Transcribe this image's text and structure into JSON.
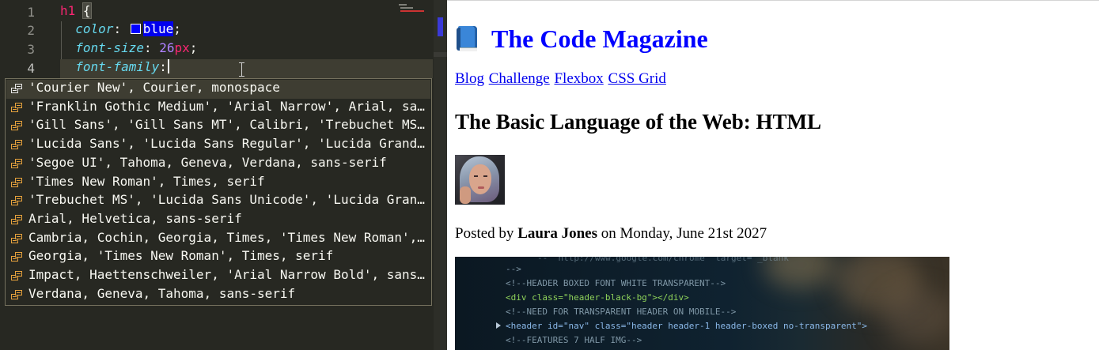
{
  "editor": {
    "line_numbers": [
      "1",
      "2",
      "3",
      "4"
    ],
    "code": {
      "selector": "h1",
      "open_brace": "{",
      "line2": {
        "prop": "color",
        "value": "blue"
      },
      "line3": {
        "prop": "font-size",
        "number": "26",
        "unit": "px"
      },
      "line4": {
        "prop": "font-family"
      },
      "colon": ":",
      "semicolon": ";"
    },
    "swatch_color": "#0000ff",
    "suggestions": [
      "'Courier New', Courier, monospace",
      "'Franklin Gothic Medium', 'Arial Narrow', Arial, sans-serif",
      "'Gill Sans', 'Gill Sans MT', Calibri, 'Trebuchet MS', sans-serif",
      "'Lucida Sans', 'Lucida Sans Regular', 'Lucida Grande', 'Lucida Sans Unicode', Geneva, Verdana, sans-serif",
      "'Segoe UI', Tahoma, Geneva, Verdana, sans-serif",
      "'Times New Roman', Times, serif",
      "'Trebuchet MS', 'Lucida Sans Unicode', 'Lucida Grande', 'Lucida Sans', Arial, sans-serif",
      "Arial, Helvetica, sans-serif",
      "Cambria, Cochin, Georgia, Times, 'Times New Roman', serif",
      "Georgia, 'Times New Roman', Times, serif",
      "Impact, Haettenschweiler, 'Arial Narrow Bold', sans-serif",
      "Verdana, Geneva, Tahoma, sans-serif"
    ],
    "suggestion_icon": "value-snippet-icon",
    "selected_suggestion": "'Courier New', Courier, monospace"
  },
  "preview": {
    "title": "The Code Magazine",
    "title_icon": "blue-book-icon",
    "title_color": "#0000ff",
    "nav": [
      "Blog",
      "Challenge",
      "Flexbox",
      "CSS Grid"
    ],
    "heading": "The Basic Language of the Web: HTML",
    "avatar": "author-photo",
    "posted_prefix": "Posted by",
    "author": "Laura Jones",
    "posted_suffix": "on Monday, June 21st 2027",
    "hero_image": "html-code-screenshot",
    "hero_code_lines": [
      "--  http://www.google.com/chrome  target=\"_blank\"",
      "-->",
      "<!--HEADER BOXED FONT WHITE TRANSPARENT-->",
      "<div class=\"header-black-bg\"></div>",
      "<!--NEED FOR TRANSPARENT HEADER ON MOBILE-->",
      "<header id=\"nav\" class=\"header header-1 header-boxed no-transparent\">",
      "<!--FEATURES 7 HALF IMG-->"
    ]
  }
}
